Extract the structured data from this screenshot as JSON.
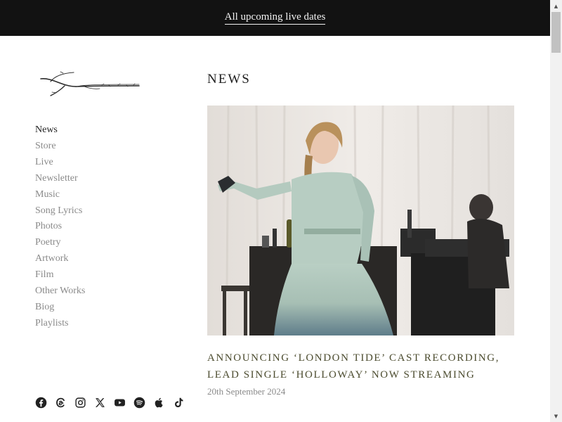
{
  "topbar": {
    "link_label": "All upcoming live dates"
  },
  "sidebar": {
    "logo_icon": "branch-logo",
    "nav": [
      {
        "label": "News",
        "active": true
      },
      {
        "label": "Store"
      },
      {
        "label": "Live"
      },
      {
        "label": "Newsletter"
      },
      {
        "label": "Music"
      },
      {
        "label": "Song Lyrics"
      },
      {
        "label": "Photos"
      },
      {
        "label": "Poetry"
      },
      {
        "label": "Artwork"
      },
      {
        "label": "Film"
      },
      {
        "label": "Other Works"
      },
      {
        "label": "Biog"
      },
      {
        "label": "Playlists"
      }
    ],
    "socials": [
      "facebook-icon",
      "threads-icon",
      "instagram-icon",
      "x-icon",
      "youtube-icon",
      "spotify-icon",
      "apple-icon",
      "tiktok-icon"
    ]
  },
  "main": {
    "section_title": "NEWS",
    "article": {
      "title": "Announcing ‘London Tide’ Cast Recording, lead single ‘Holloway’ now streaming",
      "date": "20th September 2024"
    }
  },
  "colors": {
    "topbar_bg": "#121212",
    "title_olive": "#4b4b2e",
    "nav_grey": "#8a8a8a"
  }
}
